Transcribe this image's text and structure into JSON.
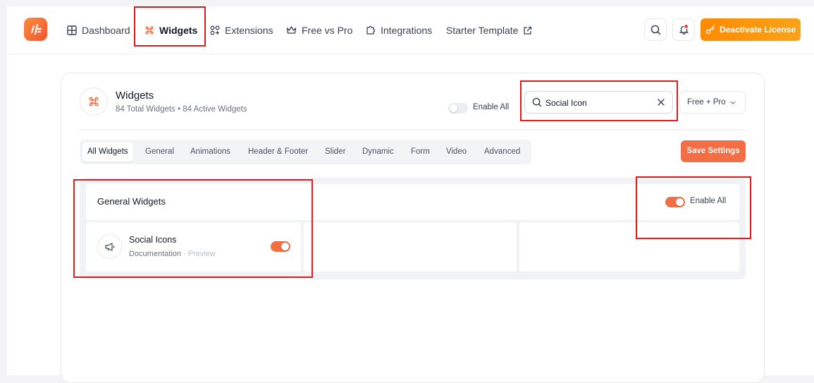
{
  "colors": {
    "accent": "#f36d45",
    "license_gradient_start": "#ff8a00",
    "highlight": "#e01919"
  },
  "nav": {
    "logo_icon": "brand-logo-icon",
    "items": [
      {
        "label": "Dashboard",
        "icon": "grid-icon"
      },
      {
        "label": "Widgets",
        "icon": "command-icon",
        "active": true
      },
      {
        "label": "Extensions",
        "icon": "extensions-icon"
      },
      {
        "label": "Free vs Pro",
        "icon": "crown-icon"
      },
      {
        "label": "Integrations",
        "icon": "puzzle-icon"
      },
      {
        "label": "Starter Template",
        "icon": "external-link-icon"
      }
    ],
    "license_button": "Deactivate License"
  },
  "header": {
    "title": "Widgets",
    "subtitle": "84 Total Widgets • 84 Active Widgets",
    "enable_all_label": "Enable All",
    "enable_all_on": false,
    "search": {
      "value": "Social Icon",
      "placeholder": "Search"
    },
    "filter": {
      "selected": "Free + Pro"
    }
  },
  "tabs": [
    {
      "label": "All Widgets",
      "active": true
    },
    {
      "label": "General"
    },
    {
      "label": "Animations"
    },
    {
      "label": "Header & Footer"
    },
    {
      "label": "Slider"
    },
    {
      "label": "Dynamic"
    },
    {
      "label": "Form"
    },
    {
      "label": "Video"
    },
    {
      "label": "Advanced"
    }
  ],
  "save_button": "Save Settings",
  "section": {
    "title": "General Widgets",
    "enable_all_label": "Enable All",
    "enable_all_on": true,
    "widgets": [
      {
        "name": "Social Icons",
        "doc_link": "Documentation",
        "separator": "·",
        "preview_link": "Preview",
        "enabled": true,
        "icon": "megaphone-icon"
      }
    ]
  }
}
